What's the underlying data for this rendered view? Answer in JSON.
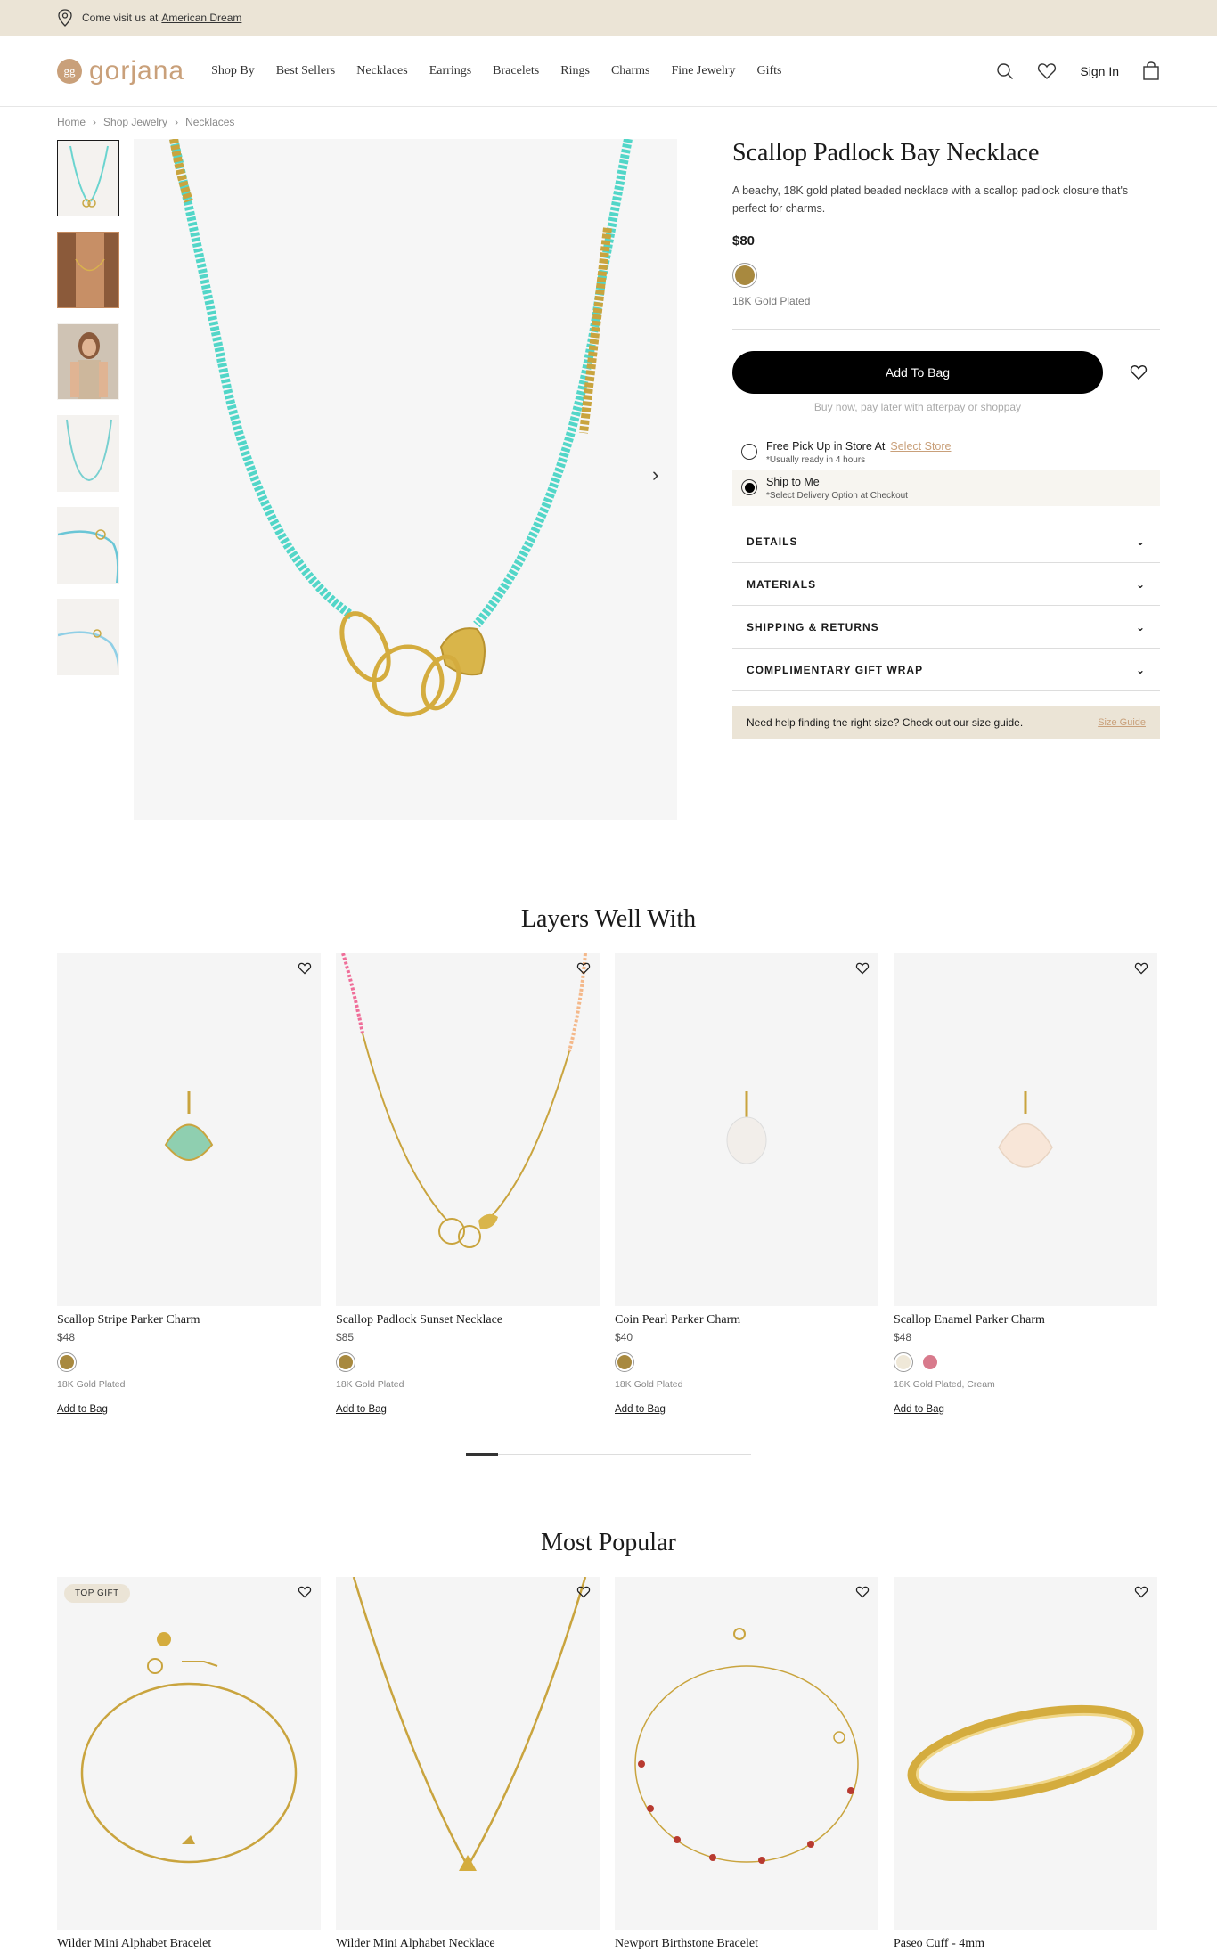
{
  "promo": {
    "text": "Come visit us at",
    "link": "American Dream"
  },
  "header": {
    "logo": "gorjana",
    "logo_mark": "gg",
    "nav": [
      "Shop By",
      "Best Sellers",
      "Necklaces",
      "Earrings",
      "Bracelets",
      "Rings",
      "Charms",
      "Fine Jewelry",
      "Gifts"
    ],
    "sign_in": "Sign In"
  },
  "breadcrumb": [
    "Home",
    "Shop Jewelry",
    "Necklaces"
  ],
  "product": {
    "title": "Scallop Padlock Bay Necklace",
    "description": "A beachy, 18K gold plated beaded necklace with a scallop padlock closure that's perfect for charms.",
    "price": "$80",
    "variant": "18K Gold Plated",
    "add_to_bag": "Add To Bag",
    "afterpay": "Buy now, pay later with afterpay or shoppay",
    "pickup_title": "Free Pick Up in Store At",
    "pickup_link": "Select Store",
    "pickup_sub": "*Usually ready in 4 hours",
    "ship_title": "Ship to Me",
    "ship_sub": "*Select Delivery Option at Checkout",
    "accordion": [
      "DETAILS",
      "MATERIALS",
      "SHIPPING & RETURNS",
      "COMPLIMENTARY GIFT WRAP"
    ],
    "size_guide_text": "Need help finding the right size? Check out our size guide.",
    "size_guide_link": "Size Guide"
  },
  "layers": {
    "title": "Layers Well With",
    "items": [
      {
        "name": "Scallop Stripe Parker Charm",
        "price": "$48",
        "variant": "18K Gold Plated",
        "add": "Add to Bag"
      },
      {
        "name": "Scallop Padlock Sunset Necklace",
        "price": "$85",
        "variant": "18K Gold Plated",
        "add": "Add to Bag"
      },
      {
        "name": "Coin Pearl Parker Charm",
        "price": "$40",
        "variant": "18K Gold Plated",
        "add": "Add to Bag"
      },
      {
        "name": "Scallop Enamel Parker Charm",
        "price": "$48",
        "variant": "18K Gold Plated, Cream",
        "add": "Add to Bag"
      }
    ]
  },
  "popular": {
    "title": "Most Popular",
    "badge": "TOP GIFT",
    "items": [
      {
        "name": "Wilder Mini Alphabet Bracelet"
      },
      {
        "name": "Wilder Mini Alphabet Necklace"
      },
      {
        "name": "Newport Birthstone Bracelet"
      },
      {
        "name": "Paseo Cuff - 4mm"
      }
    ]
  },
  "colors": {
    "gold": "#a8893f",
    "cream": "#efe8d8",
    "pink": "#d87a8c",
    "accent": "#c9a07a",
    "banner": "#ebe4d6"
  }
}
